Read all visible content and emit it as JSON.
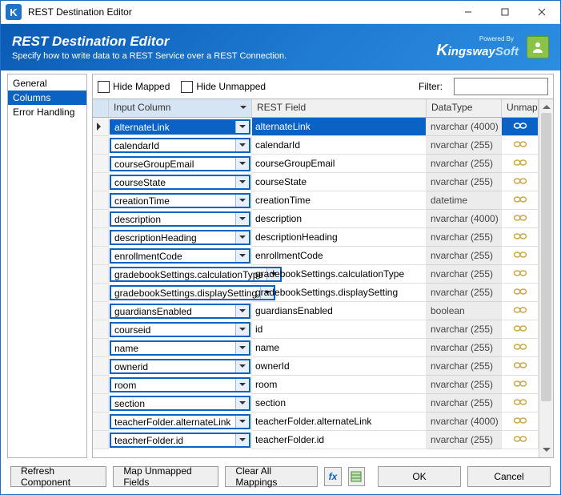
{
  "window": {
    "title": "REST Destination Editor"
  },
  "banner": {
    "title": "REST Destination Editor",
    "subtitle": "Specify how to write data to a REST Service over a REST Connection.",
    "brand_prefix": "Powered By",
    "brand": "KingswaySoft"
  },
  "sidebar": {
    "items": [
      {
        "label": "General",
        "selected": false
      },
      {
        "label": "Columns",
        "selected": true
      },
      {
        "label": "Error Handling",
        "selected": false
      }
    ]
  },
  "toolbar": {
    "hide_mapped": "Hide Mapped",
    "hide_unmapped": "Hide Unmapped",
    "filter_label": "Filter:",
    "filter_value": ""
  },
  "grid": {
    "headers": {
      "input": "Input Column",
      "rest": "REST Field",
      "type": "DataType",
      "unmap": "Unmap"
    },
    "rows": [
      {
        "input": "alternateLink",
        "rest": "alternateLink",
        "type": "nvarchar (4000)",
        "selected": true
      },
      {
        "input": "calendarId",
        "rest": "calendarId",
        "type": "nvarchar (255)"
      },
      {
        "input": "courseGroupEmail",
        "rest": "courseGroupEmail",
        "type": "nvarchar (255)"
      },
      {
        "input": "courseState",
        "rest": "courseState",
        "type": "nvarchar (255)"
      },
      {
        "input": "creationTime",
        "rest": "creationTime",
        "type": "datetime"
      },
      {
        "input": "description",
        "rest": "description",
        "type": "nvarchar (4000)"
      },
      {
        "input": "descriptionHeading",
        "rest": "descriptionHeading",
        "type": "nvarchar (255)"
      },
      {
        "input": "enrollmentCode",
        "rest": "enrollmentCode",
        "type": "nvarchar (255)"
      },
      {
        "input": "gradebookSettings.calculationType",
        "rest": "gradebookSettings.calculationType",
        "type": "nvarchar (255)"
      },
      {
        "input": "gradebookSettings.displaySetting",
        "rest": "gradebookSettings.displaySetting",
        "type": "nvarchar (255)"
      },
      {
        "input": "guardiansEnabled",
        "rest": "guardiansEnabled",
        "type": "boolean"
      },
      {
        "input": "courseid",
        "rest": "id",
        "type": "nvarchar (255)"
      },
      {
        "input": "name",
        "rest": "name",
        "type": "nvarchar (255)"
      },
      {
        "input": "ownerid",
        "rest": "ownerId",
        "type": "nvarchar (255)"
      },
      {
        "input": "room",
        "rest": "room",
        "type": "nvarchar (255)"
      },
      {
        "input": "section",
        "rest": "section",
        "type": "nvarchar (255)"
      },
      {
        "input": "teacherFolder.alternateLink",
        "rest": "teacherFolder.alternateLink",
        "type": "nvarchar (4000)"
      },
      {
        "input": "teacherFolder.id",
        "rest": "teacherFolder.id",
        "type": "nvarchar (255)"
      }
    ]
  },
  "footer": {
    "refresh": "Refresh Component",
    "mapun": "Map Unmapped Fields",
    "clear": "Clear All Mappings",
    "ok": "OK",
    "cancel": "Cancel"
  }
}
